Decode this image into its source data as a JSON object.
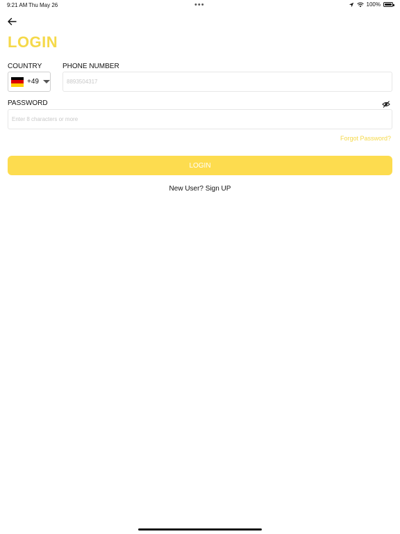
{
  "status_bar": {
    "time": "9:21 AM",
    "date": "Thu May 26",
    "dots": "•••",
    "battery": "100%"
  },
  "header": {
    "back_icon": "arrow-left-icon",
    "title": "LOGIN"
  },
  "form": {
    "country_label": "COUNTRY",
    "country_flag": "germany-flag-icon",
    "country_code": "+49",
    "phone_label": "PHONE NUMBER",
    "phone_placeholder": "8893504317",
    "password_label": "PASSWORD",
    "password_placeholder": "Enter 8 characters or more",
    "eye_icon": "eye-slash-icon",
    "forgot_password": "Forgot Password?",
    "login_button": "LOGIN",
    "signup_prompt": "New User? Sign UP"
  },
  "colors": {
    "accent": "#F5D94A",
    "button": "#FDDC4F",
    "flag_black": "#000000",
    "flag_red": "#DD0000",
    "flag_gold": "#FFCE00"
  }
}
